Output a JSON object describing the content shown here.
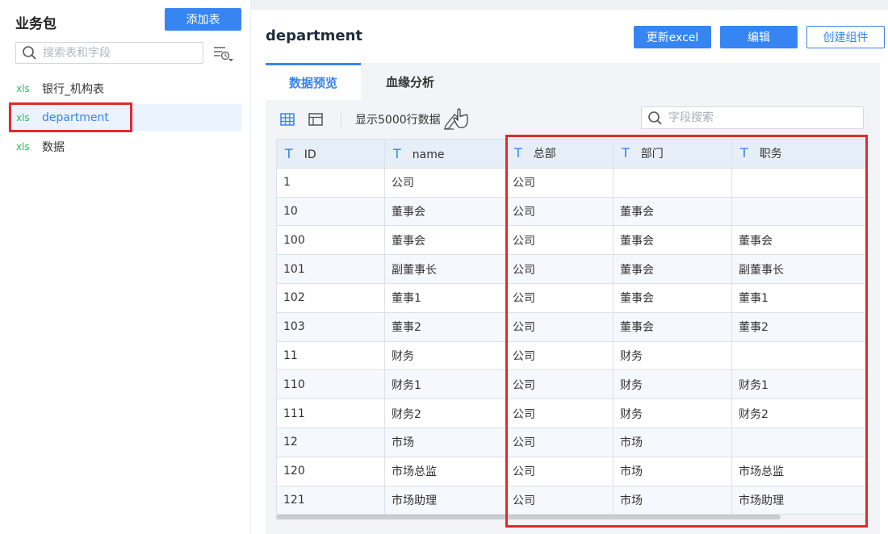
{
  "sidebar": {
    "title": "业务包",
    "add_button": "添加表",
    "search_placeholder": "搜索表和字段",
    "items": [
      {
        "tag": "xls",
        "label": "银行_机构表"
      },
      {
        "tag": "xls",
        "label": "department"
      },
      {
        "tag": "xls",
        "label": "数据"
      }
    ]
  },
  "main": {
    "title": "department",
    "buttons": {
      "update": "更新excel",
      "edit": "编辑",
      "create": "创建组件"
    },
    "tabs": [
      {
        "label": "数据预览"
      },
      {
        "label": "血缘分析"
      }
    ],
    "row_count_label": "显示5000行数据",
    "field_search_placeholder": "字段搜索",
    "type_icon": "T",
    "columns": [
      "ID",
      "name",
      "总部",
      "部门",
      "职务"
    ],
    "rows": [
      [
        "1",
        "公司",
        "公司",
        "",
        ""
      ],
      [
        "10",
        "董事会",
        "公司",
        "董事会",
        ""
      ],
      [
        "100",
        "董事会",
        "公司",
        "董事会",
        "董事会"
      ],
      [
        "101",
        "副董事长",
        "公司",
        "董事会",
        "副董事长"
      ],
      [
        "102",
        "董事1",
        "公司",
        "董事会",
        "董事1"
      ],
      [
        "103",
        "董事2",
        "公司",
        "董事会",
        "董事2"
      ],
      [
        "11",
        "财务",
        "公司",
        "财务",
        ""
      ],
      [
        "110",
        "财务1",
        "公司",
        "财务",
        "财务1"
      ],
      [
        "111",
        "财务2",
        "公司",
        "财务",
        "财务2"
      ],
      [
        "12",
        "市场",
        "公司",
        "市场",
        ""
      ],
      [
        "120",
        "市场总监",
        "公司",
        "市场",
        "市场总监"
      ],
      [
        "121",
        "市场助理",
        "公司",
        "市场",
        "市场助理"
      ]
    ]
  },
  "colors": {
    "accent": "#3685f2",
    "highlight": "#e02b2b",
    "xls": "#2fba5b"
  },
  "icons": [
    "search-icon",
    "filter-icon",
    "grid-view-icon",
    "layout-icon",
    "edit-pencil-icon",
    "hand-cursor-icon",
    "drag-handle-icon"
  ]
}
